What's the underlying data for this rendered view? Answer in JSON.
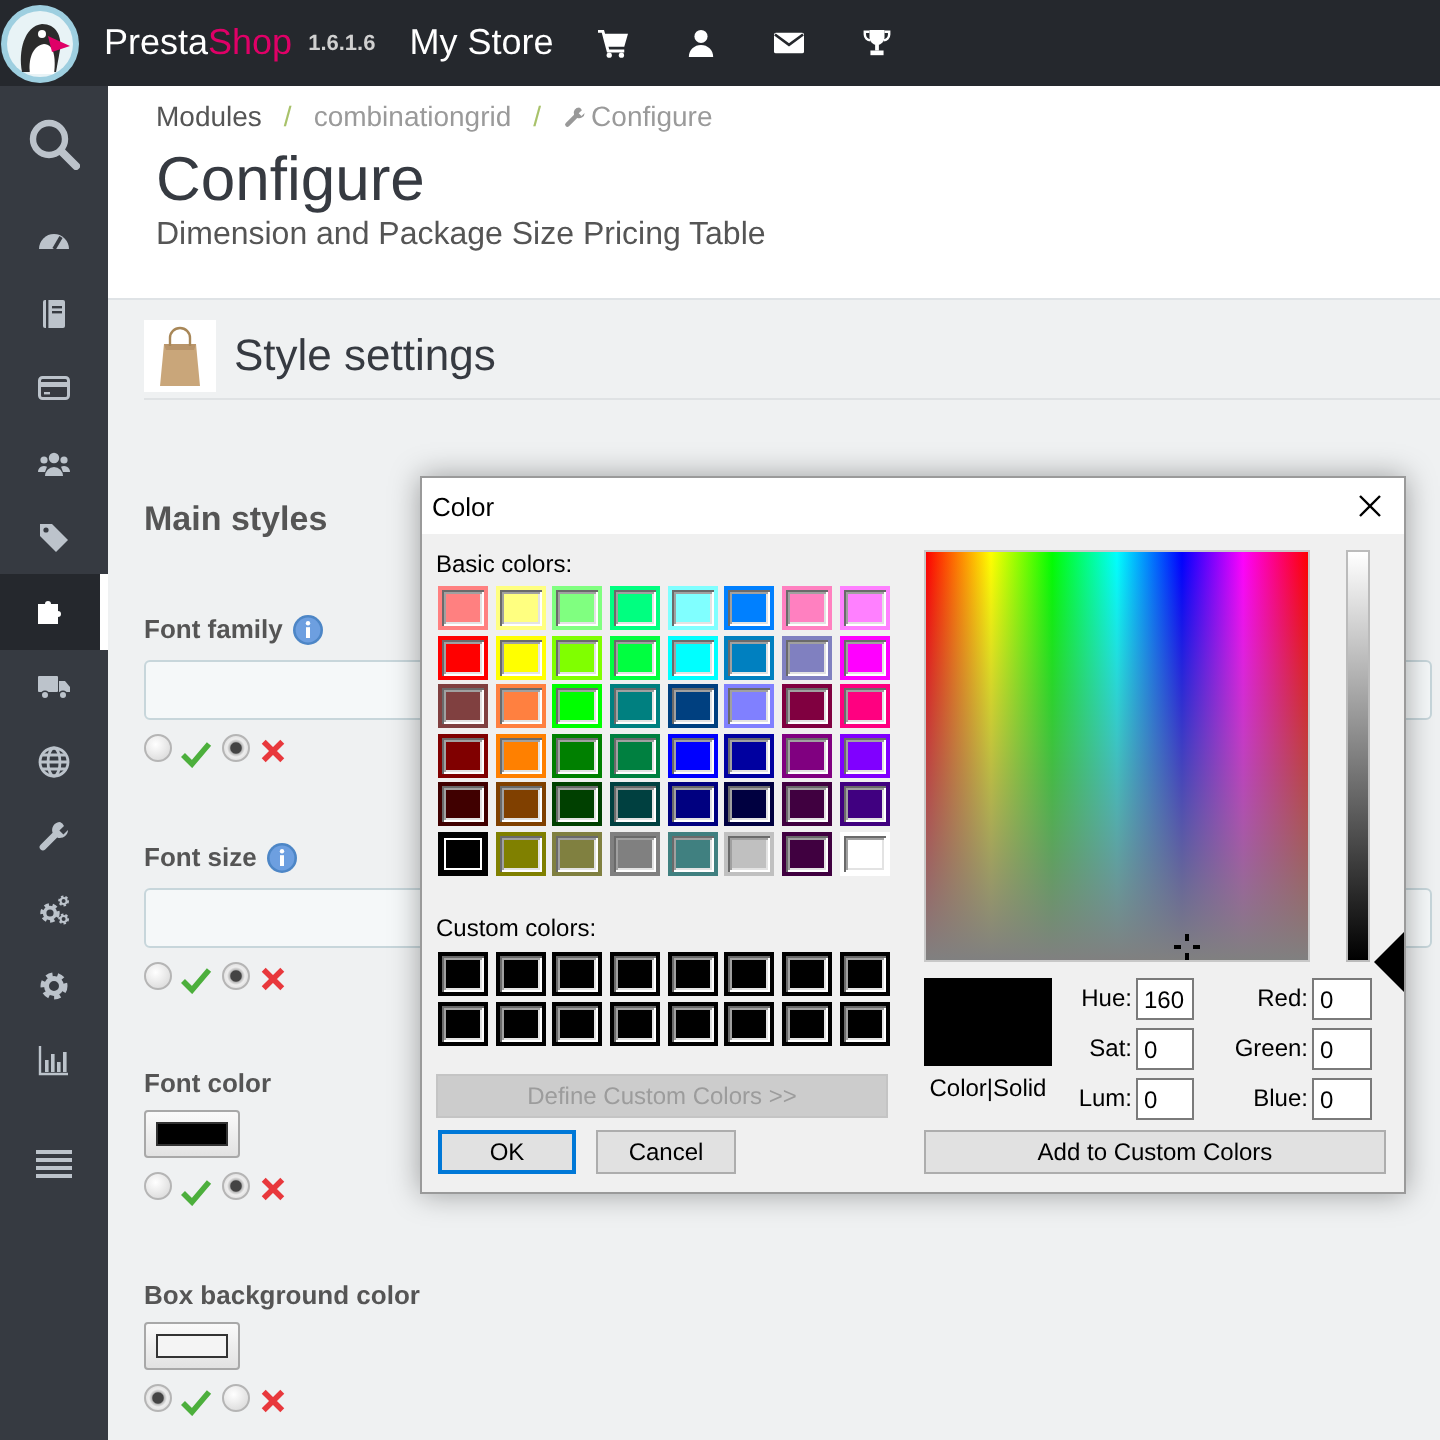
{
  "top_bar": {
    "brand_main": "Presta",
    "brand_accent": "Shop",
    "version": "1.6.1.6",
    "store_name": "My Store"
  },
  "sidebar": {
    "items": [
      {
        "selected": false
      },
      {
        "selected": false
      },
      {
        "selected": false
      },
      {
        "selected": false
      },
      {
        "selected": false
      },
      {
        "selected": true
      },
      {
        "selected": false
      },
      {
        "selected": false
      },
      {
        "selected": false
      },
      {
        "selected": false
      },
      {
        "selected": false
      },
      {
        "selected": false
      }
    ]
  },
  "page_header": {
    "breadcrumb": [
      {
        "kind": "root",
        "label": "Modules"
      },
      {
        "kind": "link",
        "separator": "/",
        "label": "combinationgrid"
      },
      {
        "kind": "current",
        "separator": "/",
        "label": "Configure"
      }
    ],
    "title": "Configure",
    "subtitle": "Dimension and Package Size Pricing Table"
  },
  "panel": {
    "title": "Style settings",
    "section_title": "Main styles",
    "fields": [
      {
        "kind": "text",
        "label": "Font family",
        "info": true,
        "options": [
          {
            "kind": "yes",
            "selected": false
          },
          {
            "kind": "no",
            "selected": true
          }
        ]
      },
      {
        "kind": "text",
        "label": "Font size",
        "info": true,
        "options": [
          {
            "kind": "yes",
            "selected": false
          },
          {
            "kind": "no",
            "selected": true
          }
        ]
      },
      {
        "kind": "color",
        "label": "Font color",
        "color": "#000000",
        "options": [
          {
            "kind": "yes",
            "selected": false
          },
          {
            "kind": "no",
            "selected": true
          }
        ]
      },
      {
        "kind": "color",
        "label": "Box background color",
        "color": "#f4f4f4",
        "options": [
          {
            "kind": "yes",
            "selected": true
          },
          {
            "kind": "no",
            "selected": false
          }
        ]
      }
    ]
  },
  "dialog": {
    "title": "Color",
    "basic_label": "Basic colors:",
    "basic_colors": [
      {
        "color": "#ff8080",
        "selected": false
      },
      {
        "color": "#ffff80",
        "selected": false
      },
      {
        "color": "#80ff80",
        "selected": false
      },
      {
        "color": "#00ff80",
        "selected": false
      },
      {
        "color": "#80ffff",
        "selected": false
      },
      {
        "color": "#0080ff",
        "selected": false
      },
      {
        "color": "#ff80c0",
        "selected": false
      },
      {
        "color": "#ff80ff",
        "selected": false
      },
      {
        "color": "#ff0000",
        "selected": false
      },
      {
        "color": "#ffff00",
        "selected": false
      },
      {
        "color": "#80ff00",
        "selected": false
      },
      {
        "color": "#00ff40",
        "selected": false
      },
      {
        "color": "#00ffff",
        "selected": false
      },
      {
        "color": "#0080c0",
        "selected": false
      },
      {
        "color": "#8080c0",
        "selected": false
      },
      {
        "color": "#ff00ff",
        "selected": false
      },
      {
        "color": "#804040",
        "selected": false
      },
      {
        "color": "#ff8040",
        "selected": false
      },
      {
        "color": "#00ff00",
        "selected": false
      },
      {
        "color": "#008080",
        "selected": false
      },
      {
        "color": "#004080",
        "selected": false
      },
      {
        "color": "#8080ff",
        "selected": false
      },
      {
        "color": "#800040",
        "selected": false
      },
      {
        "color": "#ff0080",
        "selected": false
      },
      {
        "color": "#800000",
        "selected": false
      },
      {
        "color": "#ff8000",
        "selected": false
      },
      {
        "color": "#008000",
        "selected": false
      },
      {
        "color": "#008040",
        "selected": false
      },
      {
        "color": "#0000ff",
        "selected": false
      },
      {
        "color": "#0000a0",
        "selected": false
      },
      {
        "color": "#800080",
        "selected": false
      },
      {
        "color": "#8000ff",
        "selected": false
      },
      {
        "color": "#400000",
        "selected": false
      },
      {
        "color": "#804000",
        "selected": false
      },
      {
        "color": "#004000",
        "selected": false
      },
      {
        "color": "#004040",
        "selected": false
      },
      {
        "color": "#000080",
        "selected": false
      },
      {
        "color": "#000040",
        "selected": false
      },
      {
        "color": "#400040",
        "selected": false
      },
      {
        "color": "#400080",
        "selected": false
      },
      {
        "color": "#000000",
        "selected": true
      },
      {
        "color": "#808000",
        "selected": false
      },
      {
        "color": "#808040",
        "selected": false
      },
      {
        "color": "#808080",
        "selected": false
      },
      {
        "color": "#408080",
        "selected": false
      },
      {
        "color": "#c0c0c0",
        "selected": false
      },
      {
        "color": "#400040",
        "selected": false
      },
      {
        "color": "#ffffff",
        "selected": false
      }
    ],
    "custom_label": "Custom colors:",
    "custom_colors": [
      {
        "color": "#000000"
      },
      {
        "color": "#000000"
      },
      {
        "color": "#000000"
      },
      {
        "color": "#000000"
      },
      {
        "color": "#000000"
      },
      {
        "color": "#000000"
      },
      {
        "color": "#000000"
      },
      {
        "color": "#000000"
      },
      {
        "color": "#000000"
      },
      {
        "color": "#000000"
      },
      {
        "color": "#000000"
      },
      {
        "color": "#000000"
      },
      {
        "color": "#000000"
      },
      {
        "color": "#000000"
      },
      {
        "color": "#000000"
      },
      {
        "color": "#000000"
      }
    ],
    "define_button": {
      "label": "Define Custom Colors >>",
      "disabled": true
    },
    "buttons": [
      {
        "label": "OK",
        "focused": true
      },
      {
        "label": "Cancel",
        "focused": false
      }
    ],
    "lum_slider": {
      "level": 0
    },
    "preview_label": "Color|Solid",
    "fields": [
      {
        "label": "Hue:",
        "value": "160"
      },
      {
        "label": "Red:",
        "value": "0"
      },
      {
        "label": "Sat:",
        "value": "0"
      },
      {
        "label": "Green:",
        "value": "0"
      },
      {
        "label": "Lum:",
        "value": "0"
      },
      {
        "label": "Blue:",
        "value": "0"
      }
    ],
    "add_button": {
      "label": "Add to Custom Colors"
    }
  }
}
